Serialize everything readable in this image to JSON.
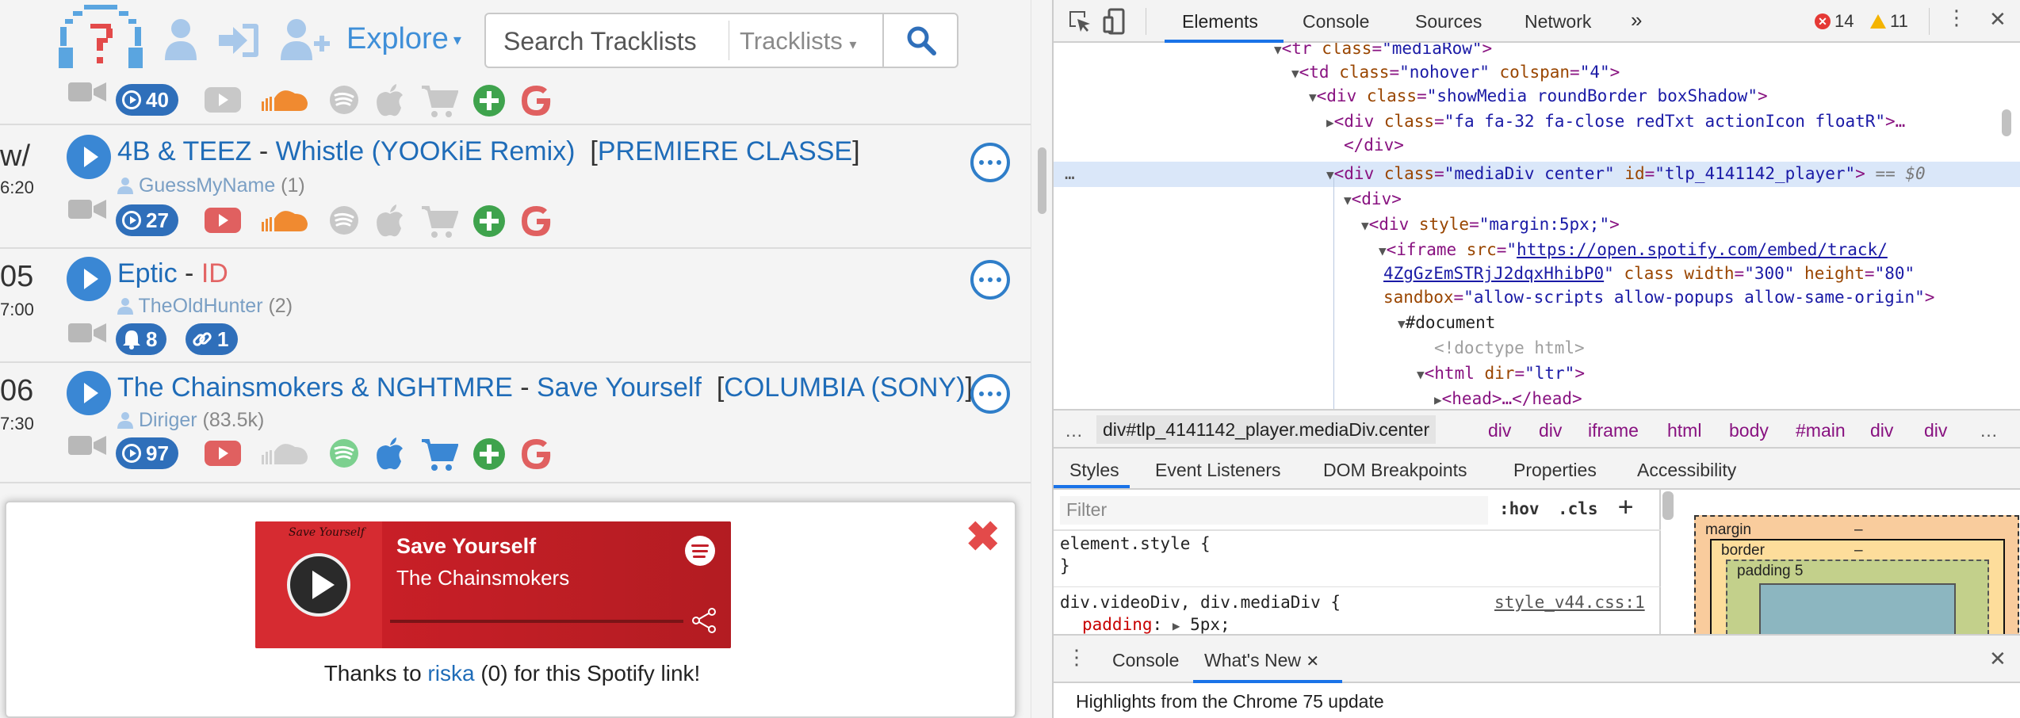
{
  "site": {
    "nav": {
      "explore_label": "Explore",
      "explore_caret": "▾"
    },
    "search": {
      "placeholder": "Search Tracklists",
      "scope": "Tracklists",
      "scope_caret": "▾"
    },
    "rows": [
      {
        "num": "",
        "time": "",
        "artist": "",
        "title": "",
        "user": "",
        "user_count": "",
        "pill": "40"
      },
      {
        "num": "w/",
        "time": "6:20",
        "artist": "4B & TEEZ",
        "dash": " - ",
        "name_a": "Whistle (",
        "name_b": "YOOKiE Remix",
        "name_c": ")",
        "label_open": "[",
        "label": "PREMIERE CLASSE",
        "label_close": "]",
        "user": "GuessMyName",
        "user_count": "(1)",
        "pill": "27"
      },
      {
        "num": "05",
        "time": "7:00",
        "artist": "Eptic",
        "dash": " - ",
        "id_label": "ID",
        "user": "TheOldHunter",
        "user_count": "(2)",
        "pill_bell": "8",
        "pill_link": "1"
      },
      {
        "num": "06",
        "time": "7:30",
        "artist": "The Chainsmokers & NGHTMRE",
        "dash": " - ",
        "name_a": "Save Yourself",
        "label_open": "[",
        "label": "COLUMBIA (SONY)",
        "label_close": "]",
        "user": "Diriger",
        "user_count": "(83.5k)",
        "pill": "97"
      }
    ],
    "popup": {
      "close": "✖",
      "art_title": "Save Yourself",
      "player_title": "Save Yourself",
      "player_artist": "The Chainsmokers",
      "thanks_before": "Thanks to ",
      "thanks_user": "riska",
      "thanks_after": " (0) for this Spotify link!"
    }
  },
  "devtools": {
    "tabs": [
      "Elements",
      "Console",
      "Sources",
      "Network"
    ],
    "more_tabs": "»",
    "errors": "14",
    "warnings": "11",
    "dom": {
      "l1_tag": "<tr ",
      "l1_attr": "class",
      "l1_val": "\"mediaRow\"",
      "l1_end": ">",
      "l2_tag": "<td ",
      "l2_attr1": "class",
      "l2_val1": "\"nohover\"",
      "l2_attr2": " colspan",
      "l2_val2": "\"4\"",
      "l2_end": ">",
      "l3_tag": "<div ",
      "l3_attr": "class",
      "l3_val": "\"showMedia roundBorder boxShadow\"",
      "l3_end": ">",
      "l4_tag": "<div ",
      "l4_attr": "class",
      "l4_val": "\"fa fa-32 fa-close redTxt actionIcon floatR\"",
      "l4_end": ">…",
      "l5": "</div>",
      "l6_tag": "<div ",
      "l6_attr1": "class",
      "l6_val1": "\"mediaDiv center\"",
      "l6_attr2": " id",
      "l6_val2": "\"tlp_4141142_player\"",
      "l6_end": ">",
      "l6_eq": " == $0",
      "l7": "<div>",
      "l8_tag": "<div ",
      "l8_attr": "style",
      "l8_val": "\"margin:5px;\"",
      "l8_end": ">",
      "l9_tag": "<iframe ",
      "l9_attr": "src",
      "l9_val_a": "\"",
      "l9_link": "https://open.spotify.com/embed/track/",
      "l10_link": "4ZgGzEmSTRjJ2dqxHhibP0",
      "l10_rest_a": "\" ",
      "l10_attr1": "class",
      "l10_attr2": " width",
      "l10_val2": "\"300\"",
      "l10_attr3": " height",
      "l10_val3": "\"80\"",
      "l11_attr": "sandbox",
      "l11_val": "\"allow-scripts allow-popups allow-same-origin\"",
      "l11_end": ">",
      "l12": "#document",
      "l13": "<!doctype html>",
      "l14_tag": "<html ",
      "l14_attr": "dir",
      "l14_val": "\"ltr\"",
      "l14_end": ">",
      "l15": "<head>…</head>"
    },
    "breadcrumb": [
      "div#tlp_4141142_player.mediaDiv.center",
      "div",
      "div",
      "iframe",
      "html",
      "body",
      "#main",
      "div",
      "div"
    ],
    "bc_more": "…",
    "sub_tabs": [
      "Styles",
      "Event Listeners",
      "DOM Breakpoints",
      "Properties",
      "Accessibility"
    ],
    "styles": {
      "filter_placeholder": "Filter",
      "hov": ":hov",
      "cls": ".cls",
      "plus": "+",
      "rule1_sel": "element.style {",
      "rule1_end": "}",
      "rule2_sel": "div.videoDiv, div.mediaDiv {",
      "rule2_src": "style_v44.css:1",
      "rule2_prop": "padding",
      "rule2_val": "5px;"
    },
    "box_model": {
      "margin": "margin",
      "margin_val": "–",
      "border": "border",
      "border_val": "–",
      "padding": "padding 5"
    },
    "drawer_tabs": [
      "Console",
      "What's New"
    ],
    "drawer_close": "✕",
    "drawer_text": "Highlights from the Chrome 75 update"
  }
}
